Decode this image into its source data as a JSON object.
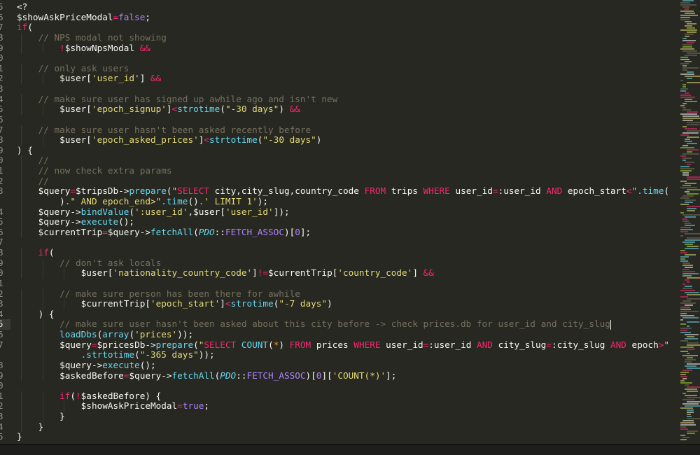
{
  "editor": {
    "active_row": 31,
    "cursor_row": 31,
    "lines": [
      {
        "n": "5",
        "ind": 0,
        "t": [
          [
            "p",
            "<?"
          ]
        ]
      },
      {
        "n": "6",
        "ind": 0,
        "t": [
          [
            "p",
            "$showAskPriceModal"
          ],
          [
            "k",
            "="
          ],
          [
            "c",
            "false"
          ],
          [
            "p",
            ";"
          ]
        ]
      },
      {
        "n": "7",
        "ind": 0,
        "t": [
          [
            "k",
            "if"
          ],
          [
            "p",
            "("
          ]
        ]
      },
      {
        "n": "8",
        "ind": 4,
        "t": [
          [
            "cm",
            "// NPS modal not showing"
          ]
        ]
      },
      {
        "n": "9",
        "ind": 8,
        "t": [
          [
            "k",
            "!"
          ],
          [
            "p",
            "$showNpsModal "
          ],
          [
            "k",
            "&&"
          ]
        ]
      },
      {
        "n": "0",
        "ind": 0,
        "t": []
      },
      {
        "n": "1",
        "ind": 4,
        "t": [
          [
            "cm",
            "// only ask users"
          ]
        ]
      },
      {
        "n": "2",
        "ind": 8,
        "t": [
          [
            "p",
            "$user["
          ],
          [
            "s",
            "'user_id'"
          ],
          [
            "p",
            "] "
          ],
          [
            "k",
            "&&"
          ]
        ]
      },
      {
        "n": "3",
        "ind": 0,
        "t": []
      },
      {
        "n": "4",
        "ind": 4,
        "t": [
          [
            "cm",
            "// make sure user has signed up awhile ago and isn't new"
          ]
        ]
      },
      {
        "n": "5",
        "ind": 8,
        "t": [
          [
            "p",
            "$user["
          ],
          [
            "s",
            "'epoch_signup'"
          ],
          [
            "p",
            "]"
          ],
          [
            "k",
            "<"
          ],
          [
            "f",
            "strotime"
          ],
          [
            "p",
            "("
          ],
          [
            "s",
            "\"-30 days\""
          ],
          [
            "p",
            ") "
          ],
          [
            "k",
            "&&"
          ]
        ]
      },
      {
        "n": "6",
        "ind": 0,
        "t": []
      },
      {
        "n": "7",
        "ind": 4,
        "t": [
          [
            "cm",
            "// make sure user hasn't been asked recently before"
          ]
        ]
      },
      {
        "n": "8",
        "ind": 8,
        "t": [
          [
            "p",
            "$user["
          ],
          [
            "s",
            "'epoch_asked_prices'"
          ],
          [
            "p",
            "]"
          ],
          [
            "k",
            "<"
          ],
          [
            "f",
            "strtotime"
          ],
          [
            "p",
            "("
          ],
          [
            "s",
            "\"-30 days\""
          ],
          [
            "p",
            ")"
          ]
        ]
      },
      {
        "n": "9",
        "ind": 0,
        "t": [
          [
            "p",
            ") {"
          ]
        ]
      },
      {
        "n": "0",
        "ind": 4,
        "t": [
          [
            "cm",
            "//"
          ]
        ]
      },
      {
        "n": "1",
        "ind": 4,
        "t": [
          [
            "cm",
            "// now check extra params"
          ]
        ]
      },
      {
        "n": "2",
        "ind": 4,
        "t": [
          [
            "cm",
            "//"
          ]
        ]
      },
      {
        "n": "3",
        "ind": 4,
        "t": [
          [
            "p",
            "$query"
          ],
          [
            "k",
            "="
          ],
          [
            "p",
            "$tripsDb->"
          ],
          [
            "f",
            "prepare"
          ],
          [
            "p",
            "("
          ],
          [
            "s",
            "\""
          ],
          [
            "k",
            "SELECT"
          ],
          [
            "p",
            " city,city_slug,country_code "
          ],
          [
            "k",
            "FROM"
          ],
          [
            "p",
            " trips "
          ],
          [
            "k",
            "WHERE"
          ],
          [
            "p",
            " user_id"
          ],
          [
            "k",
            "="
          ],
          [
            "p",
            ":user_id "
          ],
          [
            "k",
            "AND"
          ],
          [
            "p",
            " epoch_start"
          ],
          [
            "k",
            "<"
          ],
          [
            "s",
            "\""
          ],
          [
            "f",
            ".time"
          ],
          [
            "p",
            "("
          ]
        ]
      },
      {
        "n": "",
        "ind": 8,
        "t": [
          [
            "p",
            ")"
          ],
          [
            "f",
            "."
          ],
          [
            "s",
            "\" AND epoch_end>\""
          ],
          [
            "f",
            ".time"
          ],
          [
            "p",
            "()"
          ],
          [
            "f",
            "."
          ],
          [
            "s",
            "' LIMIT 1'"
          ],
          [
            "p",
            ");"
          ]
        ]
      },
      {
        "n": "4",
        "ind": 4,
        "t": [
          [
            "p",
            "$query->"
          ],
          [
            "f",
            "bindValue"
          ],
          [
            "p",
            "("
          ],
          [
            "s",
            "':user_id'"
          ],
          [
            "p",
            ",$user["
          ],
          [
            "s",
            "'user_id'"
          ],
          [
            "p",
            "]);"
          ]
        ]
      },
      {
        "n": "5",
        "ind": 4,
        "t": [
          [
            "p",
            "$query->"
          ],
          [
            "f",
            "execute"
          ],
          [
            "p",
            "();"
          ]
        ]
      },
      {
        "n": "6",
        "ind": 4,
        "t": [
          [
            "p",
            "$currentTrip"
          ],
          [
            "k",
            "="
          ],
          [
            "p",
            "$query->"
          ],
          [
            "f",
            "fetchAll"
          ],
          [
            "p",
            "("
          ],
          [
            "i",
            "PDO"
          ],
          [
            "p",
            "::"
          ],
          [
            "c",
            "FETCH_ASSOC"
          ],
          [
            "p",
            ")["
          ],
          [
            "c",
            "0"
          ],
          [
            "p",
            "];"
          ]
        ]
      },
      {
        "n": "7",
        "ind": 0,
        "t": []
      },
      {
        "n": "8",
        "ind": 4,
        "t": [
          [
            "k",
            "if"
          ],
          [
            "p",
            "("
          ]
        ]
      },
      {
        "n": "9",
        "ind": 8,
        "t": [
          [
            "cm",
            "// don't ask locals"
          ]
        ]
      },
      {
        "n": "0",
        "ind": 12,
        "t": [
          [
            "p",
            "$user["
          ],
          [
            "s",
            "'nationality_country_code'"
          ],
          [
            "p",
            "]"
          ],
          [
            "k",
            "!="
          ],
          [
            "p",
            "$currentTrip["
          ],
          [
            "s",
            "'country_code'"
          ],
          [
            "p",
            "] "
          ],
          [
            "k",
            "&&"
          ]
        ]
      },
      {
        "n": "1",
        "ind": 0,
        "t": []
      },
      {
        "n": "2",
        "ind": 8,
        "t": [
          [
            "cm",
            "// make sure person has been there for awhile"
          ]
        ]
      },
      {
        "n": "3",
        "ind": 12,
        "t": [
          [
            "p",
            "$currentTrip["
          ],
          [
            "s",
            "'epoch_start'"
          ],
          [
            "p",
            "]"
          ],
          [
            "k",
            "<"
          ],
          [
            "f",
            "strotime"
          ],
          [
            "p",
            "("
          ],
          [
            "s",
            "\"-7 days\""
          ],
          [
            "p",
            ")"
          ]
        ]
      },
      {
        "n": "4",
        "ind": 4,
        "t": [
          [
            "p",
            ") {"
          ]
        ]
      },
      {
        "n": "5",
        "ind": 8,
        "t": [
          [
            "cm",
            "// make sure user hasn't been asked about this city before -> check prices.db for user_id and city_slug"
          ]
        ]
      },
      {
        "n": "6",
        "ind": 8,
        "t": [
          [
            "f",
            "loadDbs"
          ],
          [
            "p",
            "("
          ],
          [
            "f",
            "array"
          ],
          [
            "p",
            "("
          ],
          [
            "s",
            "'prices'"
          ],
          [
            "p",
            "));"
          ]
        ]
      },
      {
        "n": "7",
        "ind": 8,
        "t": [
          [
            "p",
            "$query"
          ],
          [
            "k",
            "="
          ],
          [
            "p",
            "$pricesDb->"
          ],
          [
            "f",
            "prepare"
          ],
          [
            "p",
            "("
          ],
          [
            "s",
            "\""
          ],
          [
            "k",
            "SELECT"
          ],
          [
            "p",
            " "
          ],
          [
            "f",
            "COUNT"
          ],
          [
            "p",
            "("
          ],
          [
            "o",
            "*"
          ],
          [
            "p",
            ") "
          ],
          [
            "k",
            "FROM"
          ],
          [
            "p",
            " prices "
          ],
          [
            "k",
            "WHERE"
          ],
          [
            "p",
            " user_id"
          ],
          [
            "k",
            "="
          ],
          [
            "p",
            ":user_id "
          ],
          [
            "k",
            "AND"
          ],
          [
            "p",
            " city_slug"
          ],
          [
            "k",
            "="
          ],
          [
            "p",
            ":city_slug "
          ],
          [
            "k",
            "AND"
          ],
          [
            "p",
            " epoch"
          ],
          [
            "k",
            ">"
          ],
          [
            "s",
            "\""
          ]
        ]
      },
      {
        "n": "",
        "ind": 12,
        "t": [
          [
            "f",
            ".strtotime"
          ],
          [
            "p",
            "("
          ],
          [
            "s",
            "\"-365 days\""
          ],
          [
            "p",
            "));"
          ]
        ]
      },
      {
        "n": "8",
        "ind": 8,
        "t": [
          [
            "p",
            "$query->"
          ],
          [
            "f",
            "execute"
          ],
          [
            "p",
            "();"
          ]
        ]
      },
      {
        "n": "9",
        "ind": 8,
        "t": [
          [
            "p",
            "$askedBefore"
          ],
          [
            "k",
            "="
          ],
          [
            "p",
            "$query->"
          ],
          [
            "f",
            "fetchAll"
          ],
          [
            "p",
            "("
          ],
          [
            "i",
            "PDO"
          ],
          [
            "p",
            "::"
          ],
          [
            "c",
            "FETCH_ASSOC"
          ],
          [
            "p",
            ")["
          ],
          [
            "c",
            "0"
          ],
          [
            "p",
            "]["
          ],
          [
            "s",
            "'COUNT(*)'"
          ],
          [
            "p",
            "];"
          ]
        ]
      },
      {
        "n": "0",
        "ind": 0,
        "t": []
      },
      {
        "n": "1",
        "ind": 8,
        "t": [
          [
            "k",
            "if"
          ],
          [
            "p",
            "("
          ],
          [
            "k",
            "!"
          ],
          [
            "p",
            "$askedBefore) {"
          ]
        ]
      },
      {
        "n": "2",
        "ind": 12,
        "t": [
          [
            "p",
            "$showAskPriceModal"
          ],
          [
            "k",
            "="
          ],
          [
            "c",
            "true"
          ],
          [
            "p",
            ";"
          ]
        ]
      },
      {
        "n": "3",
        "ind": 8,
        "t": [
          [
            "p",
            "}"
          ]
        ]
      },
      {
        "n": "4",
        "ind": 4,
        "t": [
          [
            "p",
            "}"
          ]
        ]
      },
      {
        "n": "5",
        "ind": 0,
        "t": [
          [
            "p",
            "}"
          ]
        ]
      }
    ]
  },
  "colors": {
    "background": "#272822",
    "keyword": "#f92672",
    "string": "#e6db74",
    "function": "#66d9ef",
    "constant": "#ae81ff",
    "comment": "#75715e"
  }
}
